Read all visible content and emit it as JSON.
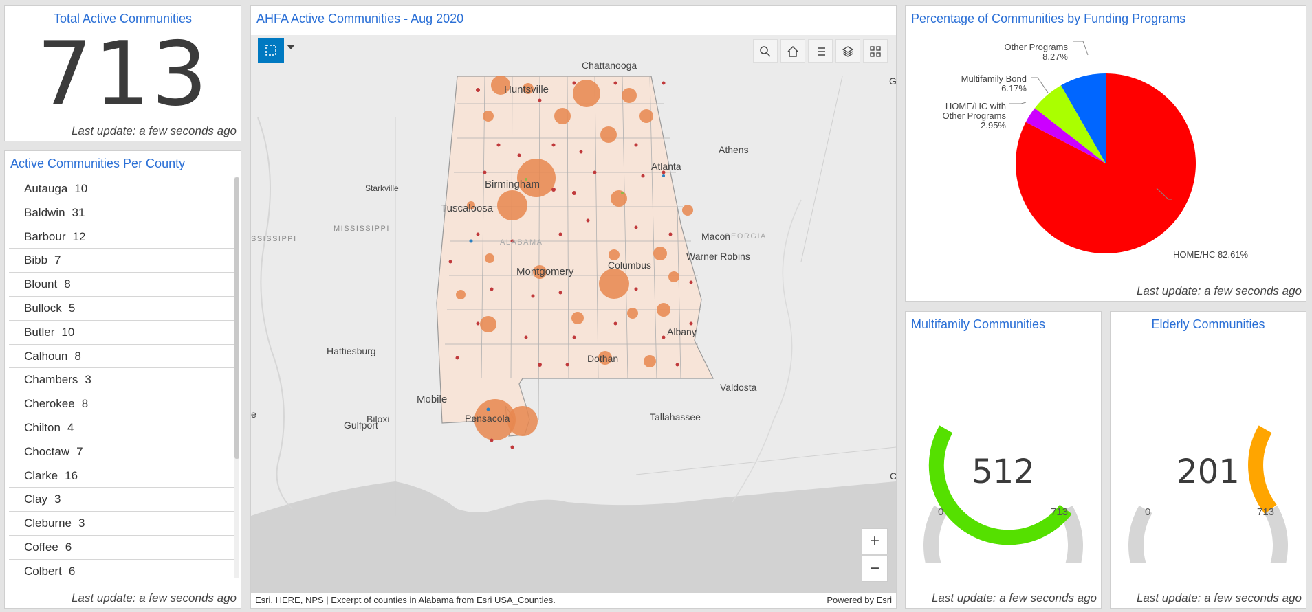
{
  "total": {
    "title": "Total Active Communities",
    "value": "713",
    "updated": "Last update: a few seconds ago"
  },
  "county": {
    "title": "Active Communities Per County",
    "items": [
      {
        "name": "Autauga",
        "count": "10"
      },
      {
        "name": "Baldwin",
        "count": "31"
      },
      {
        "name": "Barbour",
        "count": "12"
      },
      {
        "name": "Bibb",
        "count": "7"
      },
      {
        "name": "Blount",
        "count": "8"
      },
      {
        "name": "Bullock",
        "count": "5"
      },
      {
        "name": "Butler",
        "count": "10"
      },
      {
        "name": "Calhoun",
        "count": "8"
      },
      {
        "name": "Chambers",
        "count": "3"
      },
      {
        "name": "Cherokee",
        "count": "8"
      },
      {
        "name": "Chilton",
        "count": "4"
      },
      {
        "name": "Choctaw",
        "count": "7"
      },
      {
        "name": "Clarke",
        "count": "16"
      },
      {
        "name": "Clay",
        "count": "3"
      },
      {
        "name": "Cleburne",
        "count": "3"
      },
      {
        "name": "Coffee",
        "count": "6"
      },
      {
        "name": "Colbert",
        "count": "6"
      }
    ],
    "updated": "Last update: a few seconds ago"
  },
  "map": {
    "title": "AHFA Active Communities - Aug 2020",
    "attribution": "Esri, HERE, NPS | Excerpt of counties in Alabama from Esri USA_Counties.",
    "powered": "Powered by Esri",
    "zoom_in": "+",
    "zoom_out": "−",
    "labels": {
      "chattanooga": "Chattanooga",
      "huntsville": "Huntsville",
      "athens": "Athens",
      "atlanta": "Atlanta",
      "starkville": "Starkville",
      "birmingham": "Birmingham",
      "tuscaloosa": "Tuscaloosa",
      "mississippi": "MISSISSIPPI",
      "mississippi_edge": "SSISSIPPI",
      "alabama": "ALABAMA",
      "georgia": "GEORGIA",
      "macon": "Macon",
      "warner_robins": "Warner Robins",
      "montgomery": "Montgomery",
      "columbus": "Columbus",
      "albany": "Albany",
      "hattiesburg": "Hattiesburg",
      "dothan": "Dothan",
      "valdosta": "Valdosta",
      "mobile": "Mobile",
      "biloxi": "Biloxi",
      "gulfport": "Gulfport",
      "pensacola": "Pensacola",
      "tallahassee": "Tallahassee",
      "edge_g": "G",
      "edge_e": "e",
      "edge_c": "C"
    },
    "accent": "#0079c1",
    "point_color": "#e8874f"
  },
  "funding": {
    "title": "Percentage of Communities by Funding Programs",
    "updated": "Last update: a few seconds ago",
    "chart_data": {
      "type": "pie",
      "categories": [
        "HOME/HC",
        "HOME/HC with Other Programs",
        "Multifamily Bond",
        "Other Programs"
      ],
      "values": [
        82.61,
        2.95,
        6.17,
        8.27
      ],
      "colors": [
        "#ff0000",
        "#cc00ff",
        "#aaff00",
        "#0066ff"
      ],
      "labels": {
        "homehc": "HOME/HC 82.61%",
        "other1": "Other Programs",
        "other2": "8.27%",
        "bond1": "Multifamily Bond",
        "bond2": "6.17%",
        "with1": "HOME/HC with",
        "with2": "Other Programs",
        "with3": "2.95%"
      }
    }
  },
  "multifamily": {
    "title": "Multifamily Communities",
    "value": 512,
    "display": "512",
    "min": "0",
    "max": "713",
    "max_value": 713,
    "color": "#55e000",
    "updated": "Last update: a few seconds ago"
  },
  "elderly": {
    "title": "Elderly Communities",
    "value": 201,
    "display": "201",
    "min": "0",
    "max": "713",
    "max_value": 713,
    "color": "#ffa500",
    "updated": "Last update: a few seconds ago"
  }
}
